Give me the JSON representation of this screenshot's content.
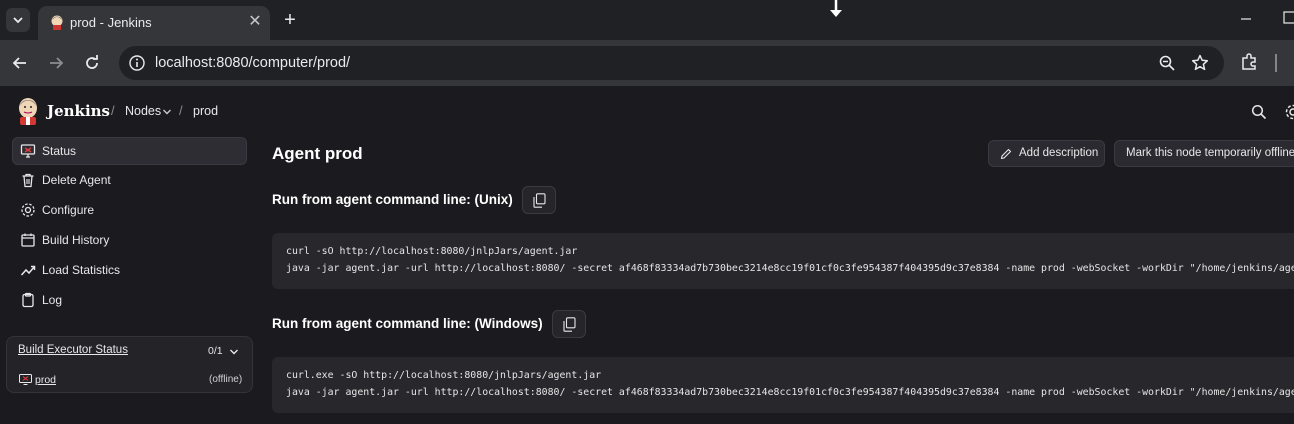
{
  "browser": {
    "tab": {
      "title": "prod - Jenkins",
      "close_glyph": "✕"
    },
    "new_tab_glyph": "+",
    "url": "localhost:8080/computer/prod/",
    "theme_colors": {
      "tabstrip": "#202124",
      "toolbar": "#35363a",
      "omnibox": "#202124"
    }
  },
  "jenkins": {
    "brand": "Jenkins",
    "breadcrumb": {
      "sep": "/",
      "nodes": "Nodes",
      "current": "prod"
    },
    "header_icons": [
      "search-icon",
      "gear-icon"
    ]
  },
  "sidebar": {
    "items": [
      {
        "label": "Status",
        "icon": "monitor-icon",
        "active": true
      },
      {
        "label": "Delete Agent",
        "icon": "trash-icon"
      },
      {
        "label": "Configure",
        "icon": "gear-icon"
      },
      {
        "label": "Build History",
        "icon": "history-icon"
      },
      {
        "label": "Load Statistics",
        "icon": "chart-line-icon"
      },
      {
        "label": "Log",
        "icon": "clipboard-icon"
      }
    ],
    "executor": {
      "title": "Build Executor Status",
      "count": "0/1",
      "node": "prod",
      "node_status": "(offline)"
    }
  },
  "main": {
    "title": "Agent prod",
    "buttons": {
      "add_description": "Add description",
      "mark_offline": "Mark this node temporarily offline"
    },
    "unix": {
      "heading": "Run from agent command line: (Unix)",
      "lines": [
        "curl -sO http://localhost:8080/jnlpJars/agent.jar",
        "java -jar agent.jar -url http://localhost:8080/ -secret af468f83334ad7b730bec3214e8cc19f01cf0c3fe954387f404395d9c37e8384 -name prod -webSocket -workDir \"/home/jenkins/agent\""
      ]
    },
    "windows": {
      "heading": "Run from agent command line: (Windows)",
      "lines": [
        "curl.exe -sO http://localhost:8080/jnlpJars/agent.jar",
        "java -jar agent.jar -url http://localhost:8080/ -secret af468f83334ad7b730bec3214e8cc19f01cf0c3fe954387f404395d9c37e8384 -name prod -webSocket -workDir \"/home/jenkins/agent\""
      ]
    }
  },
  "colors": {
    "page_bg": "#1b1b1f",
    "panel": "#2d2d33",
    "code_bg": "#27272c",
    "text": "#e8e8ea"
  }
}
